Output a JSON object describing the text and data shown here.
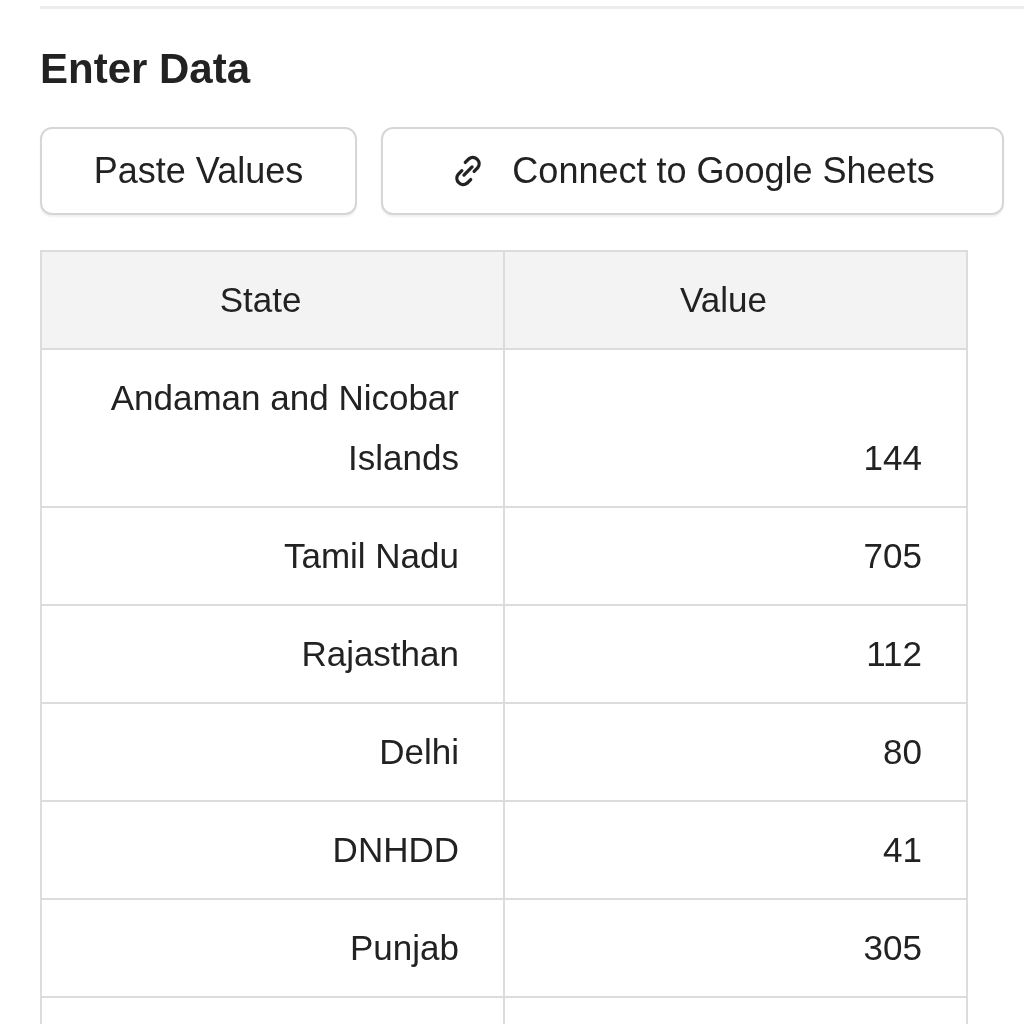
{
  "section": {
    "title": "Enter Data"
  },
  "buttons": [
    {
      "label": "Paste Values",
      "kind": "plain"
    },
    {
      "label": "Connect to Google Sheets",
      "kind": "link"
    }
  ],
  "table": {
    "columns": [
      "State",
      "Value"
    ],
    "rows": [
      [
        "Andaman and Nicobar Islands",
        "144"
      ],
      [
        "Tamil Nadu",
        "705"
      ],
      [
        "Rajasthan",
        "112"
      ],
      [
        "Delhi",
        "80"
      ],
      [
        "DNHDD",
        "41"
      ],
      [
        "Punjab",
        "305"
      ]
    ]
  }
}
